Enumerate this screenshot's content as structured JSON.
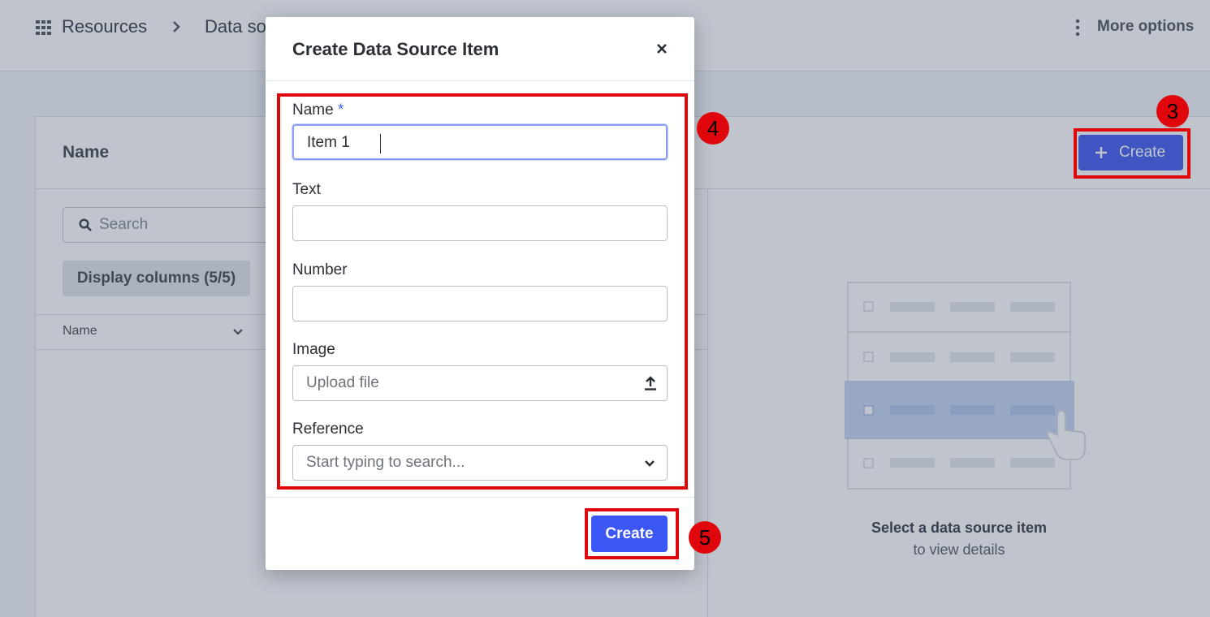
{
  "breadcrumb": {
    "icon": "grid-icon",
    "root": "Resources",
    "separator_icon": "chevron-right-icon",
    "current": "Data so"
  },
  "header": {
    "more_icon": "kebab-menu-icon",
    "more_label": "More options"
  },
  "list_panel": {
    "title": "Name",
    "search_placeholder": "Search",
    "display_columns_label": "Display columns (5/5)",
    "columns": [
      {
        "label": "Name",
        "sort_icon": "chevron-down-icon"
      }
    ],
    "create_label": "Create"
  },
  "empty_state": {
    "title": "Select a data source item",
    "subtitle": "to view details"
  },
  "modal": {
    "title": "Create Data Source Item",
    "close_icon": "close-icon",
    "fields": {
      "name": {
        "label": "Name",
        "required_mark": "*",
        "value": "Item 1"
      },
      "text": {
        "label": "Text",
        "value": ""
      },
      "number": {
        "label": "Number",
        "value": ""
      },
      "image": {
        "label": "Image",
        "placeholder": "Upload file",
        "icon": "upload-icon"
      },
      "reference": {
        "label": "Reference",
        "placeholder": "Start typing to search...",
        "icon": "chevron-down-icon"
      }
    },
    "submit_label": "Create"
  },
  "annotations": [
    {
      "number": "3"
    },
    {
      "number": "4"
    },
    {
      "number": "5"
    }
  ],
  "colors": {
    "accent": "#3a57f6",
    "annotation_red": "#e0070c"
  }
}
